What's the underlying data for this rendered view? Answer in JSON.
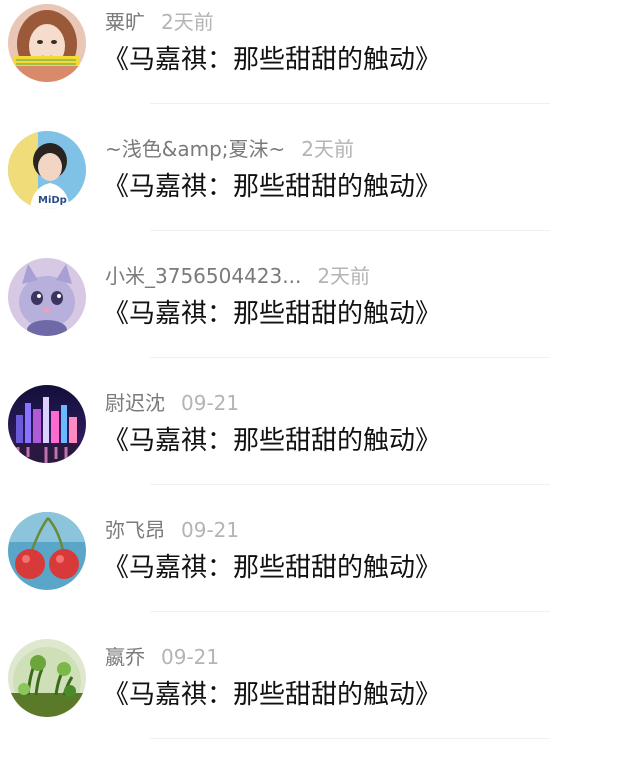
{
  "comments": [
    {
      "user": "粟旷",
      "time": "2天前",
      "title": "《马嘉祺：那些甜甜的触动》",
      "avatar": "girl-portrait"
    },
    {
      "user": "~浅色&amp;夏沫~",
      "time": "2天前",
      "title": "《马嘉祺：那些甜甜的触动》",
      "avatar": "boy-portrait"
    },
    {
      "user": "小米_3756504423...",
      "time": "2天前",
      "title": "《马嘉祺：那些甜甜的触动》",
      "avatar": "cat-doll"
    },
    {
      "user": "尉迟沈",
      "time": "09-21",
      "title": "《马嘉祺：那些甜甜的触动》",
      "avatar": "city-night"
    },
    {
      "user": "弥飞昂",
      "time": "09-21",
      "title": "《马嘉祺：那些甜甜的触动》",
      "avatar": "cherries"
    },
    {
      "user": "嬴乔",
      "time": "09-21",
      "title": "《马嘉祺：那些甜甜的触动》",
      "avatar": "terrarium"
    }
  ],
  "colors": {
    "username": "#7a7a7a",
    "timestamp": "#b4b4b4",
    "title": "#111111",
    "divider": "#f0f0f0"
  }
}
